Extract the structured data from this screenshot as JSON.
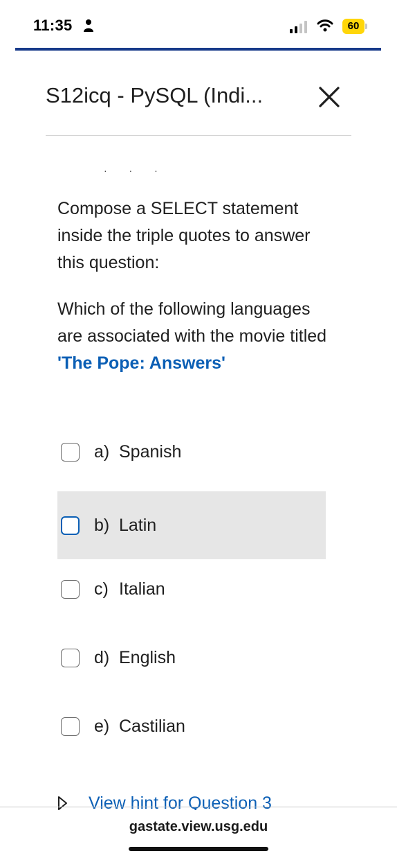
{
  "status_bar": {
    "time": "11:35",
    "battery": "60"
  },
  "header": {
    "title": "S12icq - PySQL (Indi...",
    "close_label": "Close"
  },
  "question": {
    "intro": "Compose a SELECT statement inside the triple quotes to answer this question:",
    "prompt": "Which of the following languages are associated with the movie titled ",
    "highlight": "'The Pope: Answers'"
  },
  "options": [
    {
      "letter": "a)",
      "text": "Spanish"
    },
    {
      "letter": "b)",
      "text": "Latin"
    },
    {
      "letter": "c)",
      "text": "Italian"
    },
    {
      "letter": "d)",
      "text": "English"
    },
    {
      "letter": "e)",
      "text": "Castilian"
    }
  ],
  "hint": {
    "label": "View hint for Question 3"
  },
  "browser": {
    "url": "gastate.view.usg.edu"
  },
  "colors": {
    "accent": "#0b5fb5",
    "top_rule": "#173a8a",
    "battery": "#ffd60a",
    "hover_bg": "#e6e6e6"
  }
}
